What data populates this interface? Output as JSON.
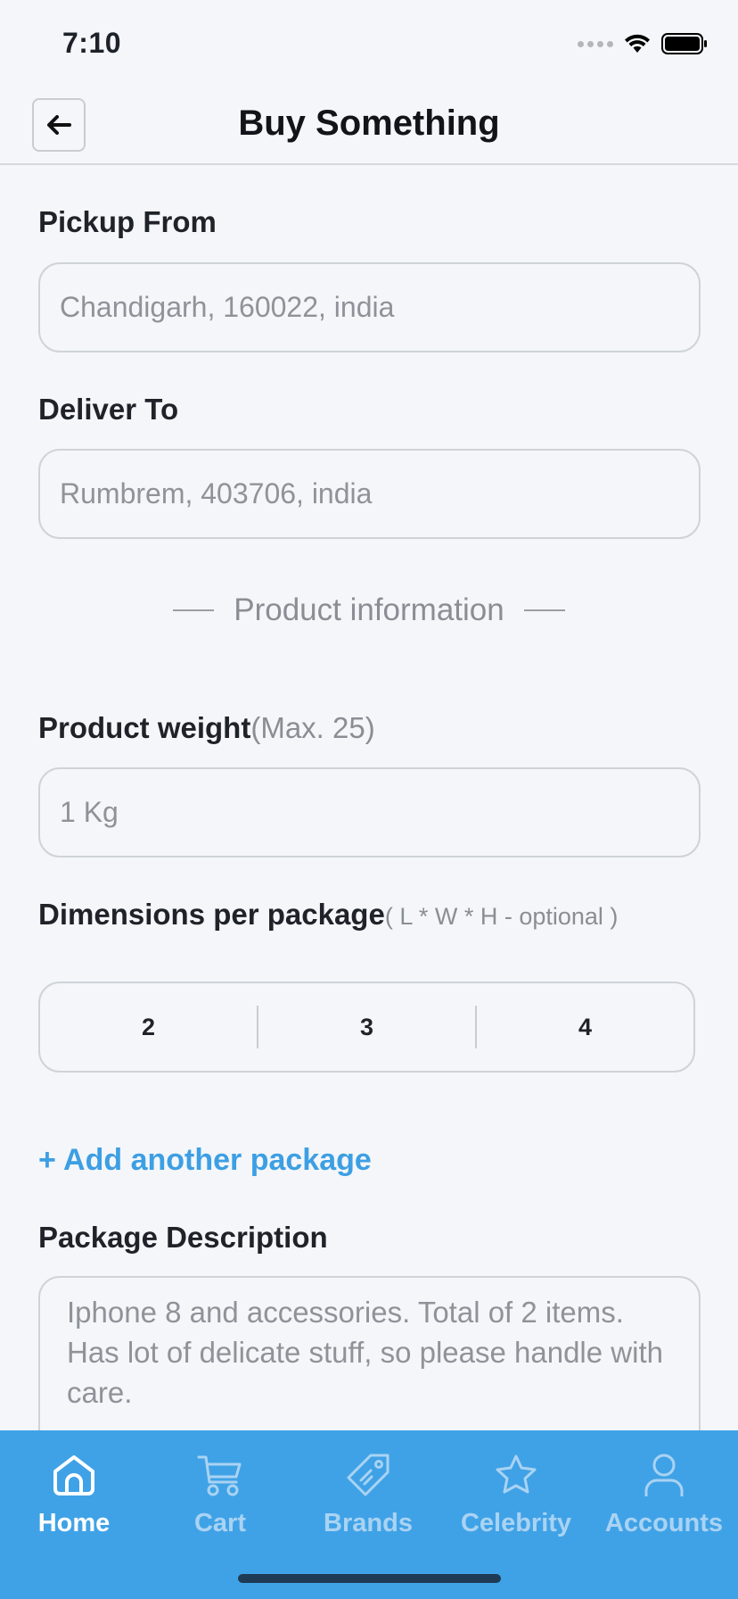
{
  "status_bar": {
    "time": "7:10"
  },
  "header": {
    "title": "Buy Something"
  },
  "pickup": {
    "label": "Pickup From",
    "placeholder": "Chandigarh, 160022, india"
  },
  "deliver": {
    "label": "Deliver To",
    "placeholder": "Rumbrem, 403706, india"
  },
  "product_section": {
    "title": "Product information"
  },
  "weight": {
    "label": "Product weight",
    "hint": "(Max. 25)",
    "value": "1 Kg"
  },
  "dimensions": {
    "label": "Dimensions per package",
    "hint": "( L * W * H - optional )",
    "length": "2",
    "width": "3",
    "height": "4"
  },
  "add_package": {
    "label": "+ Add another package"
  },
  "description": {
    "label": "Package Description",
    "placeholder": "Iphone 8 and accessories. Total of 2 items. Has lot of delicate stuff, so please handle with care."
  },
  "tabs": [
    {
      "label": "Home",
      "icon": "home-icon",
      "active": true
    },
    {
      "label": "Cart",
      "icon": "cart-icon",
      "active": false
    },
    {
      "label": "Brands",
      "icon": "tag-icon",
      "active": false
    },
    {
      "label": "Celebrity",
      "icon": "star-icon",
      "active": false
    },
    {
      "label": "Accounts",
      "icon": "user-icon",
      "active": false
    }
  ],
  "colors": {
    "accent": "#40a2e6",
    "link": "#3d9fe3",
    "background": "#f4f6f9"
  }
}
